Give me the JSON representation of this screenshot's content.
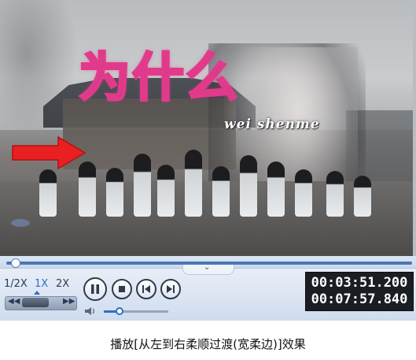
{
  "video": {
    "overlay_title": "为什么",
    "overlay_subtitle": "wei shenme"
  },
  "playback": {
    "progress": 0.016,
    "speed_options": [
      "1/2X",
      "1X",
      "2X"
    ],
    "selected_speed": "1X",
    "volume_level": 0.2
  },
  "time": {
    "current": "00:03:51.200",
    "total": "00:07:57.840"
  },
  "icons": {
    "expand": "chevron-down-icon",
    "rewind": "rewind-icon",
    "fast_forward": "fast-forward-icon",
    "pause": "pause-icon",
    "stop": "stop-icon",
    "previous": "previous-icon",
    "next": "next-icon",
    "volume": "speaker-icon"
  },
  "colors": {
    "accent": "#2f6ec6",
    "title_fill": "#6a4a8e",
    "title_stroke": "#e23a8a",
    "arrow": "#e8201f"
  },
  "caption": "播放[从左到右柔顺过渡(宽柔边)]效果"
}
